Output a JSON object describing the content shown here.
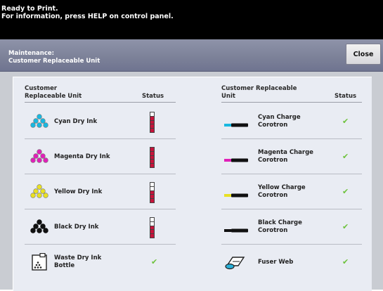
{
  "message": {
    "line1": "Ready to Print.",
    "line2": "For information, press HELP on control panel."
  },
  "titlebar": {
    "line1": "Maintenance:",
    "line2": "Customer Replaceable Unit",
    "close_label": "Close"
  },
  "left_table": {
    "header_unit_line1": "Customer",
    "header_unit_line2": "Replaceable Unit",
    "header_status": "Status",
    "rows": [
      {
        "line1": "Cyan Dry Ink",
        "line2": "",
        "icon": "cyan-ink-icon",
        "color": "#19b8e0",
        "status": "gauge",
        "level": 0.75
      },
      {
        "line1": "Magenta Dry Ink",
        "line2": "",
        "icon": "magenta-ink-icon",
        "color": "#e020b8",
        "status": "gauge",
        "level": 1.0
      },
      {
        "line1": "Yellow Dry Ink",
        "line2": "",
        "icon": "yellow-ink-icon",
        "color": "#e8e024",
        "status": "gauge",
        "level": 0.5
      },
      {
        "line1": "Black Dry Ink",
        "line2": "",
        "icon": "black-ink-icon",
        "color": "#111111",
        "status": "gauge",
        "level": 0.5
      },
      {
        "line1": "Waste Dry Ink",
        "line2": "Bottle",
        "icon": "waste-bottle-icon",
        "color": "#333333",
        "status": "ok"
      }
    ]
  },
  "right_table": {
    "header_unit_line1": "Customer Replaceable",
    "header_unit_line2": "Unit",
    "header_status": "Status",
    "rows": [
      {
        "line1": "Cyan Charge",
        "line2": "Corotron",
        "icon": "cyan-corotron-icon",
        "color": "#19b8e0",
        "status": "ok"
      },
      {
        "line1": "Magenta Charge",
        "line2": "Corotron",
        "icon": "magenta-corotron-icon",
        "color": "#e020b8",
        "status": "ok"
      },
      {
        "line1": "Yellow Charge",
        "line2": "Corotron",
        "icon": "yellow-corotron-icon",
        "color": "#e8e024",
        "status": "ok"
      },
      {
        "line1": "Black Charge",
        "line2": "Corotron",
        "icon": "black-corotron-icon",
        "color": "#111111",
        "status": "ok"
      },
      {
        "line1": "Fuser Web",
        "line2": "",
        "icon": "fuser-web-icon",
        "color": "#2ab0d8",
        "status": "ok"
      }
    ]
  },
  "colors": {
    "gauge_fill": "#c6143b",
    "check": "#6ec23c",
    "titlebar": "#7d8299",
    "panel": "#e9ecf3"
  },
  "check_glyph": "✔"
}
